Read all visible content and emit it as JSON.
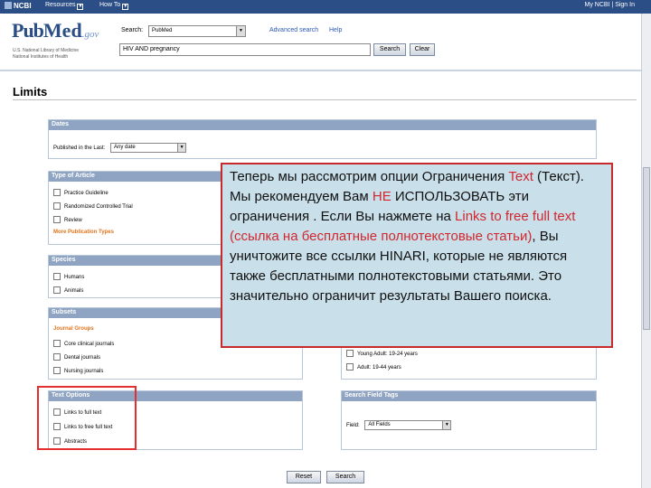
{
  "topbar": {
    "ncbi_label": "NCBI",
    "resources_label": "Resources",
    "howto_label": "How To",
    "account_label": "My NCBI | Sign In"
  },
  "header": {
    "logo_pub": "Pub",
    "logo_med": "Med",
    "logo_gov": ".gov",
    "logo_sub_line1": "U.S. National Library of Medicine",
    "logo_sub_line2": "National Institutes of Health",
    "search_label": "Search:",
    "database_value": "PubMed",
    "advanced_link": "Advanced search",
    "help_link": "Help",
    "query_value": "HIV AND pregnancy",
    "search_button": "Search",
    "clear_button": "Clear"
  },
  "limits": {
    "title": "Limits"
  },
  "dates": {
    "heading": "Dates",
    "published_label": "Published in the Last:",
    "published_value": "Any date"
  },
  "type_of_article": {
    "heading": "Type of Article",
    "items": [
      "Practice Guideline",
      "Randomized Controlled Trial",
      "Review"
    ],
    "more_link": "More Publication Types"
  },
  "species": {
    "heading": "Species",
    "items": [
      "Humans",
      "Animals"
    ]
  },
  "subsets": {
    "heading": "Subsets",
    "group_label": "Journal Groups",
    "items": [
      "Core clinical journals",
      "Dental journals",
      "Nursing journals"
    ]
  },
  "ages": {
    "items": [
      "Young Adult: 19-24 years",
      "Adult: 19-44 years"
    ]
  },
  "text_options": {
    "heading": "Text Options",
    "items": [
      "Links to full text",
      "Links to free full text",
      "Abstracts"
    ]
  },
  "search_field_tags": {
    "heading": "Search Field Tags",
    "field_label": "Field:",
    "field_value": "All Fields"
  },
  "footer": {
    "reset_button": "Reset",
    "search_button": "Search"
  },
  "overlay": {
    "part1": "Теперь мы рассмотрим опции Ограничения ",
    "text_word": "Text",
    "part2": " (Текст). Мы рекомендуем Вам ",
    "ne_word": "НЕ",
    "part3": " ",
    "ispolzovat_word": "ИСПОЛЬЗОВАТЬ",
    "part4": " эти ограничения . Если Вы нажмете на ",
    "links_phrase": "Links to free full text (ссылка на бесплатные полнотекстовые статьи)",
    "part5": ", Вы уничтожите все ссылки HINARI, которые не являются также бесплатными полнотекстовыми статьями. Это значительно ограничит результаты Вашего поиска."
  },
  "colors": {
    "ncbi_bar": "#2a4e85",
    "panel_header": "#8fa4c2",
    "highlight_red": "#d2272e",
    "overlay_bg": "#c9dfe9",
    "orange_label": "#e0741c"
  }
}
